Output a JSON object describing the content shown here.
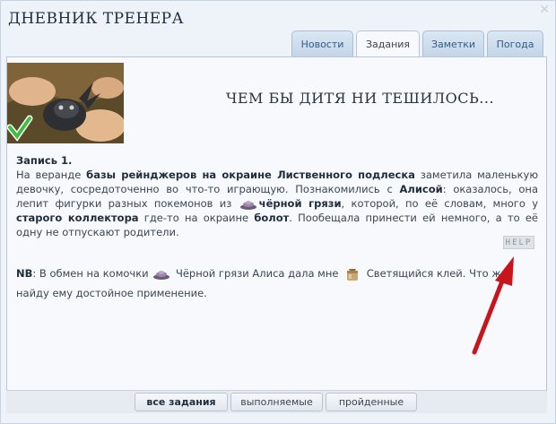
{
  "window": {
    "title": "ДНЕВНИК ТРЕНЕРА",
    "close_glyph": "✕"
  },
  "tabs": [
    {
      "label": "Новости",
      "active": false
    },
    {
      "label": "Задания",
      "active": true
    },
    {
      "label": "Заметки",
      "active": false
    },
    {
      "label": "Погода",
      "active": false
    }
  ],
  "task": {
    "heading": "ЧЕМ БЫ ДИТЯ НИ ТЕШИЛОСЬ...",
    "entry_title": "Запись 1.",
    "p1": "На веранде ",
    "p1_bold": "базы рейнджеров на окраине Лиственного подлеска",
    "p2": " заметила маленькую девочку, сосредоточенно во что-то играющую. Познакомились с ",
    "p2_bold": "Алисой",
    "p3": ": оказалось, она лепит фигурки разных покемонов из ",
    "p3_bold": "чёрной грязи",
    "p4": ", которой, по её словам, много у ",
    "p4_bold": "старого коллектора",
    "p5": " где-то на окраине ",
    "p5_bold": "болот",
    "p6": ". Пообещала принести ей немного, а то её одну не отпускают родители.",
    "help_label": "HELP",
    "nb_label": "NB",
    "nb1": ": В обмен на комочки ",
    "nb2": " Чёрной грязи Алиса дала мне ",
    "nb3": " Светящийся клей. Что ж, найду ему достойное применение."
  },
  "filters": [
    {
      "label": "все задания",
      "active": true
    },
    {
      "label": "выполняемые",
      "active": false
    },
    {
      "label": "пройденные",
      "active": false
    }
  ],
  "colors": {
    "accent_arrow": "#c8141b",
    "tab_text": "#2f5d8c",
    "check": "#3fbf3f"
  },
  "icons": [
    "mud-icon",
    "jar-icon",
    "checkmark-icon",
    "close-icon"
  ]
}
